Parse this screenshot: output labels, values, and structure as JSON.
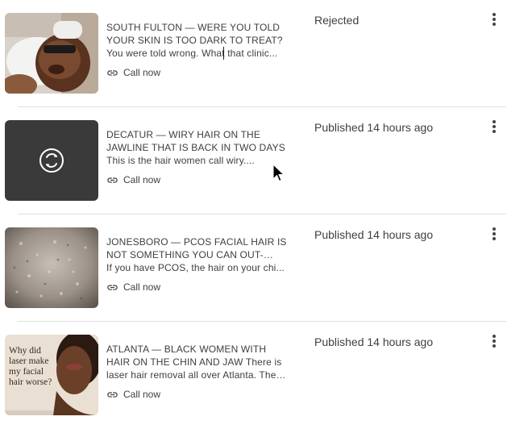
{
  "posts": [
    {
      "headline": "SOUTH FULTON — WERE YOU TOLD YOUR SKIN IS TOO DARK TO TREAT?",
      "summary": "You were told wrong. What that clinic...",
      "action_label": "Call now",
      "status": "Rejected"
    },
    {
      "headline": "DECATUR — WIRY HAIR ON THE JAWLINE THAT IS BACK IN TWO DAYS",
      "summary": "This is the hair women call wiry....",
      "action_label": "Call now",
      "status": "Published 14 hours ago"
    },
    {
      "headline": "JONESBORO — PCOS FACIAL HAIR IS NOT SOMETHING YOU CAN OUT-SHAVE",
      "summary": "If you have PCOS, the hair on your chi...",
      "action_label": "Call now",
      "status": "Published 14 hours ago"
    },
    {
      "headline": "ATLANTA — BLACK WOMEN WITH HAIR ON THE CHIN AND JAW There is laser hair removal all over Atlanta. There is...",
      "action_label": "Call now",
      "status": "Published 14 hours ago",
      "thumb_text": "Why did laser make my facial hair worse?"
    }
  ],
  "icons": {
    "action": "link-icon",
    "menu": "more-vert-icon",
    "processing": "sync-icon"
  },
  "colors": {
    "text": "#3c4043",
    "divider": "#e0e0e0",
    "processing_tile": "#3a3a3a"
  }
}
